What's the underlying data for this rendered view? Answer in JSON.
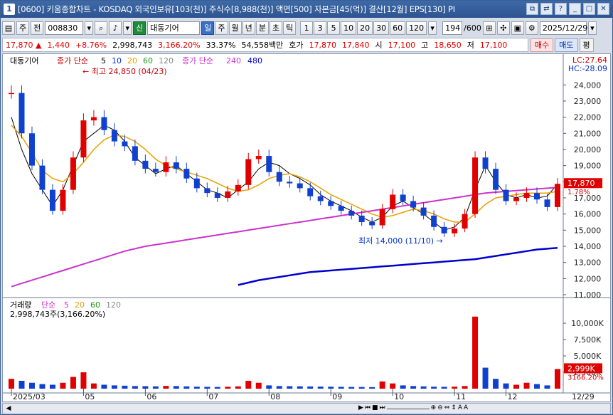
{
  "window": {
    "number": "1",
    "title": "[0600] 키움종합차트 - KOSDAQ 외국인보유[103(천)] 주식수[8,988(천)] 액면[500] 자본금[45(억)] 결산[12월] EPS[130] PI",
    "buttons": [
      "restore-icon",
      "link-icon",
      "question-icon",
      "minimize-icon",
      "maximize-icon",
      "close-icon"
    ]
  },
  "toolbar": {
    "menu_icon": "chart-icon",
    "period_label": "주",
    "prev_label": "전",
    "code_value": "008830",
    "stock_name": "대동기어",
    "sin_label": "신",
    "periods": [
      "일",
      "주",
      "월",
      "년",
      "분",
      "초",
      "틱"
    ],
    "selected_period": "일",
    "intervals": [
      "1",
      "3",
      "5",
      "10",
      "20",
      "30",
      "60",
      "120"
    ],
    "count_value": "194",
    "count_total": "/600",
    "date_value": "2025/12/29"
  },
  "price": {
    "current": "17,870",
    "change_arrow": "▲",
    "change": "1,440",
    "change_pct": "+8.76%",
    "volume": "2,998,743",
    "volume_ratio": "3,166.20%",
    "turnover": "33.37%",
    "amount": "54,558백만",
    "ask_label": "호가",
    "ask1": "17,870",
    "ask2": "17,840",
    "open_label": "시",
    "open": "17,100",
    "high_label": "고",
    "high": "18,650",
    "low_label": "저",
    "low": "17,100",
    "buy_label": "매수",
    "sell_label": "매도",
    "flat_label": "평"
  },
  "chart": {
    "legend_stock": "대동기어",
    "legend_ma_label": "종가 단순",
    "legend_ma": [
      "5",
      "10",
      "20",
      "60",
      "120"
    ],
    "legend_ma_colors": [
      "#000000",
      "#0033cc",
      "#e8a000",
      "#1a9a1a",
      "#888888"
    ],
    "legend_ma2_label": "종가 단순",
    "legend_ma2": [
      "240",
      "480"
    ],
    "legend_ma2_colors": [
      "#cc33cc",
      "#0000cc"
    ],
    "lc_label": "LC:27.64",
    "hc_label": "HC:-28.09",
    "high_note": "최고 24,850 (04/23)",
    "low_note": "최저 14,000 (11/10)",
    "price_ticks": [
      "24,000",
      "23,000",
      "22,000",
      "21,000",
      "20,000",
      "19,000",
      "18,000",
      "17,000",
      "16,000",
      "15,000",
      "14,000",
      "13,000",
      "12,000",
      "11,000"
    ],
    "price_tag": "17,870",
    "pct_tag": "1.78%",
    "volume_legend_label": "거래량",
    "volume_legend_ma_label": "단순",
    "volume_legend_ma": [
      "5",
      "20",
      "60",
      "120"
    ],
    "volume_note": "2,998,743주(3,166.20%)",
    "volume_ticks": [
      "10,000K",
      "7,500K",
      "5,000K",
      "2,500K"
    ],
    "volume_tag": "2,999K",
    "volume_pct_tag": "3166.20%",
    "x_ticks": [
      "2025/03",
      "05",
      "06",
      "07",
      "08",
      "09",
      "10",
      "11",
      "12"
    ],
    "x_last": "12/29",
    "colors": {
      "up": "#e00000",
      "down": "#1040d0"
    }
  },
  "chart_data": {
    "type": "candlestick",
    "title": "",
    "ylabel": "",
    "ylim": [
      11000,
      24850
    ],
    "series": [
      {
        "name": "종가 단순 5",
        "values": [
          22000,
          20000,
          18500,
          17500,
          16500,
          17500,
          19000,
          20500,
          21000,
          21500,
          21200,
          20500,
          19500,
          19000,
          18500,
          18800,
          19000,
          18500,
          18000,
          17500,
          17300,
          17000,
          17500,
          18000,
          18800,
          19200,
          19000,
          18500,
          18200,
          17800,
          17200,
          16800,
          16500,
          16200,
          15800,
          15500,
          15800,
          16500,
          16800,
          16400,
          16000,
          15500,
          15000,
          15200,
          15800,
          17500,
          19000,
          18000,
          17200,
          17000,
          17200,
          17000,
          17100,
          17870
        ]
      },
      {
        "name": "종가 단순 20",
        "values": [
          21500,
          20800,
          19800,
          18700,
          18200,
          18000,
          18500,
          19200,
          20000,
          20600,
          20900,
          20800,
          20500,
          20000,
          19400,
          19000,
          18800,
          18600,
          18400,
          18200,
          17900,
          17600,
          17400,
          17500,
          17800,
          18200,
          18400,
          18500,
          18300,
          18000,
          17600,
          17200,
          16900,
          16600,
          16300,
          16000,
          15800,
          15900,
          16100,
          16300,
          16200,
          16000,
          15700,
          15500,
          15500,
          16000,
          16600,
          17000,
          17100,
          17200,
          17300,
          17300,
          17300,
          17400
        ]
      },
      {
        "name": "종가 단순 240",
        "values": [
          11500,
          11700,
          11900,
          12100,
          12300,
          12500,
          12700,
          12900,
          13100,
          13300,
          13500,
          13700,
          13850,
          14000,
          14100,
          14200,
          14300,
          14400,
          14500,
          14600,
          14700,
          14800,
          14900,
          15000,
          15100,
          15200,
          15300,
          15400,
          15500,
          15600,
          15700,
          15800,
          15900,
          16000,
          16100,
          16200,
          16300,
          16400,
          16500,
          16600,
          16700,
          16800,
          16900,
          17000,
          17100,
          17200,
          17300,
          17350,
          17400,
          17450,
          17500,
          17550,
          17600,
          17650
        ]
      },
      {
        "name": "종가 단순 480",
        "values": [
          null,
          null,
          null,
          null,
          null,
          null,
          null,
          null,
          null,
          null,
          null,
          null,
          null,
          null,
          null,
          null,
          null,
          null,
          null,
          null,
          null,
          null,
          11600,
          11750,
          11900,
          12000,
          12100,
          12200,
          12300,
          12400,
          12450,
          12500,
          12550,
          12600,
          12650,
          12700,
          12750,
          12800,
          12850,
          12900,
          12950,
          13000,
          13050,
          13100,
          13150,
          13200,
          13300,
          13400,
          13500,
          13600,
          13700,
          13800,
          13850,
          13900
        ]
      }
    ],
    "close": [
      23500,
      21000,
      19000,
      17500,
      16200,
      17500,
      19500,
      21800,
      22000,
      21200,
      20500,
      20200,
      19300,
      18800,
      18600,
      19200,
      18800,
      18200,
      17600,
      17300,
      17000,
      17400,
      17800,
      19400,
      19600,
      18600,
      18000,
      17900,
      17600,
      17100,
      16800,
      16500,
      16200,
      15900,
      15500,
      15300,
      16300,
      17200,
      16800,
      16400,
      15900,
      15200,
      14800,
      15100,
      16000,
      19500,
      18800,
      17500,
      16800,
      17000,
      17300,
      16900,
      16430,
      17870
    ],
    "volume_k": [
      1500,
      1200,
      900,
      700,
      600,
      900,
      1800,
      2500,
      800,
      600,
      500,
      450,
      400,
      380,
      350,
      420,
      400,
      350,
      300,
      280,
      260,
      300,
      350,
      1200,
      900,
      500,
      400,
      380,
      360,
      340,
      320,
      300,
      280,
      260,
      250,
      240,
      1100,
      800,
      500,
      400,
      350,
      300,
      280,
      300,
      400,
      11000,
      3200,
      1500,
      800,
      600,
      900,
      700,
      500,
      2999
    ]
  }
}
